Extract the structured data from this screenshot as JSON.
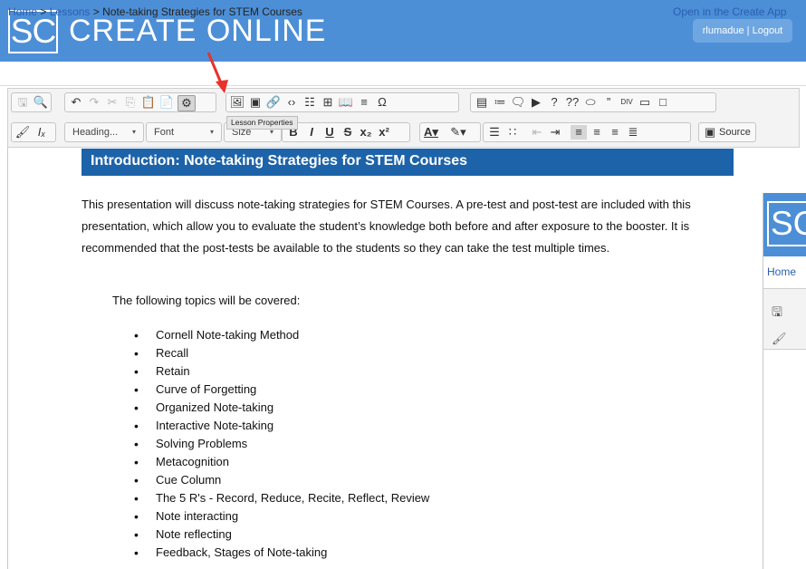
{
  "header": {
    "logo_text": "SC",
    "title": "CREATE ONLINE",
    "username": "rlumadue",
    "separator": "|",
    "logout": "Logout"
  },
  "breadcrumb": {
    "home": "Home",
    "sep": ">",
    "lessons": "Lessons",
    "current": "Note-taking Strategies for STEM Courses",
    "open_app": "Open in the Create App"
  },
  "toolbar": {
    "heading_combo": "Heading...",
    "font_combo": "Font",
    "size_combo": "Size",
    "source_label": "Source",
    "tooltip": "Lesson Properties"
  },
  "document": {
    "heading": "Introduction: Note-taking Strategies for STEM Courses",
    "paragraph": "This presentation will discuss note-taking strategies for STEM Courses.  A pre-test and post-test are included with this presentation, which allow you to evaluate the student’s knowledge both before and after exposure to the booster. It is recommended that the post-tests be available to the students so they can take the test multiple times.",
    "topics_intro": "The following topics will be covered:",
    "topics": [
      "Cornell Note-taking Method",
      "Recall",
      "Retain",
      "Curve of Forgetting",
      "Organized Note-taking",
      "Interactive Note-taking",
      "Solving Problems",
      "Metacognition",
      "Cue Column",
      "The 5 R's - Record, Reduce, Recite, Reflect, Review",
      "Note interacting",
      "Note reflecting",
      "Feedback, Stages of Note-taking"
    ]
  },
  "second_window": {
    "logo_text": "SC",
    "home": "Home"
  },
  "colors": {
    "header_blue": "#4d8fd6",
    "heading_blue": "#1d63a9",
    "link_blue": "#2a5db0",
    "arrow_red": "#e8322b"
  }
}
